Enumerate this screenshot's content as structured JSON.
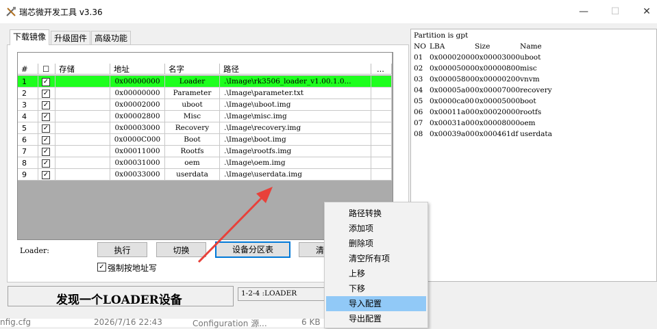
{
  "window": {
    "title": "瑞芯微开发工具 v3.36",
    "minimize_glyph": "—",
    "maximize_glyph": "☐",
    "close_glyph": "✕"
  },
  "tabs": [
    {
      "label": "下载镜像",
      "active": true
    },
    {
      "label": "升级固件",
      "active": false
    },
    {
      "label": "高级功能",
      "active": false
    }
  ],
  "table": {
    "columns": [
      "#",
      "存储",
      "地址",
      "名字",
      "路径",
      "..."
    ],
    "header_checkbox": "☐",
    "rows": [
      {
        "num": "1",
        "checked": "✓",
        "address": "0x00000000",
        "name": "Loader",
        "path": ".\\Image\\rk3506_loader_v1.00.1.0...",
        "selected": true
      },
      {
        "num": "2",
        "checked": "✓",
        "address": "0x00000000",
        "name": "Parameter",
        "path": ".\\Image\\parameter.txt"
      },
      {
        "num": "3",
        "checked": "✓",
        "address": "0x00002000",
        "name": "uboot",
        "path": ".\\Image\\uboot.img"
      },
      {
        "num": "4",
        "checked": "✓",
        "address": "0x00002800",
        "name": "Misc",
        "path": ".\\Image\\misc.img"
      },
      {
        "num": "5",
        "checked": "✓",
        "address": "0x00003000",
        "name": "Recovery",
        "path": ".\\Image\\recovery.img"
      },
      {
        "num": "6",
        "checked": "✓",
        "address": "0x0000C000",
        "name": "Boot",
        "path": ".\\Image\\boot.img"
      },
      {
        "num": "7",
        "checked": "✓",
        "address": "0x00011000",
        "name": "Rootfs",
        "path": ".\\Image\\rootfs.img"
      },
      {
        "num": "8",
        "checked": "✓",
        "address": "0x00031000",
        "name": "oem",
        "path": ".\\Image\\oem.img"
      },
      {
        "num": "9",
        "checked": "✓",
        "address": "0x00033000",
        "name": "userdata",
        "path": ".\\Image\\userdata.img"
      }
    ]
  },
  "controls": {
    "loader_label": "Loader:",
    "run_button": "执行",
    "switch_button": "切换",
    "partition_table_button": "设备分区表",
    "clear_button_partial": "清",
    "force_address_checkbox": "✓",
    "force_address_label": "强制按地址写"
  },
  "partition_panel": {
    "header": "Partition is gpt",
    "columns": [
      "NO",
      "LBA",
      "Size",
      "Name"
    ],
    "rows": [
      [
        "01",
        "0x00002000",
        "0x00003000",
        "uboot"
      ],
      [
        "02",
        "0x00005000",
        "0x00000800",
        "misc"
      ],
      [
        "03",
        "0x00005800",
        "0x00000200",
        "vnvm"
      ],
      [
        "04",
        "0x00005a00",
        "0x00007000",
        "recovery"
      ],
      [
        "05",
        "0x0000ca00",
        "0x00005000",
        "boot"
      ],
      [
        "06",
        "0x00011a00",
        "0x00020000",
        "rootfs"
      ],
      [
        "07",
        "0x00031a00",
        "0x00008000",
        "oem"
      ],
      [
        "08",
        "0x00039a00",
        "0x000461df",
        "userdata"
      ]
    ]
  },
  "status": {
    "message": "发现一个LOADER设备",
    "device": "1-2-4 :LOADER"
  },
  "context_menu": {
    "items": [
      "路径转换",
      "添加项",
      "删除项",
      "清空所有项",
      "上移",
      "下移",
      "导入配置",
      "导出配置"
    ],
    "highlighted_index": 6
  },
  "background_strip": {
    "file_name": "nfig.cfg",
    "date": "2026/7/16 22:43",
    "type": "Configuration 源...",
    "size": "6 KB"
  },
  "colors": {
    "selected_row": "#1eff1e",
    "menu_highlight": "#91c9f7",
    "arrow": "#e8413a",
    "focus_border": "#0078d7"
  }
}
